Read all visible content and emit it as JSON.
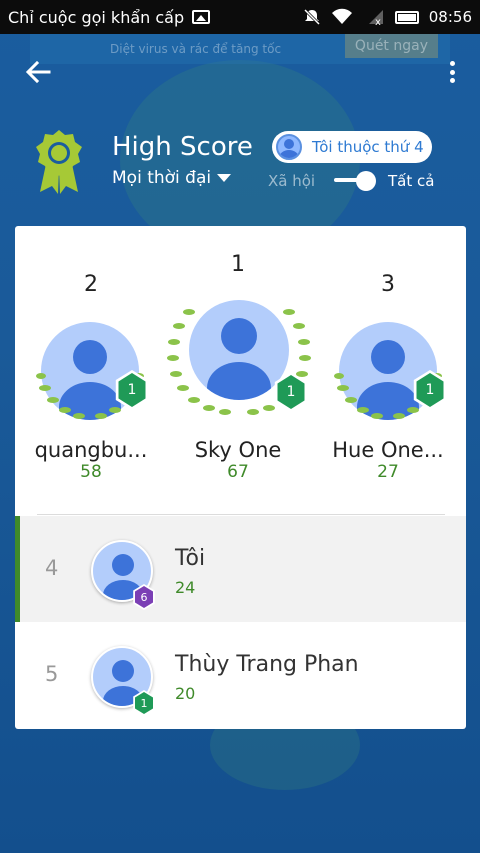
{
  "status_bar": {
    "carrier": "Chỉ cuộc gọi khẩn cấp",
    "time": "08:56",
    "icons": [
      "image-icon",
      "silent-icon",
      "wifi-icon",
      "signal-off-icon",
      "battery-icon"
    ]
  },
  "ad": {
    "text": "Diệt virus và rác để tăng tốc",
    "button": "Quét ngay"
  },
  "header": {
    "title": "High Score",
    "period": "Mọi thời đại",
    "my_rank_pill": "Tôi thuộc thứ 4",
    "social_label": "Xã hội",
    "all_label": "Tất cả",
    "toggle_on": true
  },
  "podium": [
    {
      "rank": "2",
      "name": "quangbu...",
      "score": "58",
      "level": "1"
    },
    {
      "rank": "1",
      "name": "Sky One",
      "score": "67",
      "level": "1"
    },
    {
      "rank": "3",
      "name": "Hue One...",
      "score": "27",
      "level": "1"
    }
  ],
  "list": [
    {
      "rank": "4",
      "name": "Tôi",
      "score": "24",
      "level": "6",
      "level_color": "#7b3fb5",
      "is_me": true
    },
    {
      "rank": "5",
      "name": "Thùy Trang Phan",
      "score": "20",
      "level": "1",
      "level_color": "#1f9a57",
      "is_me": false
    }
  ],
  "colors": {
    "accent_green": "#3f8a2a",
    "level_green": "#1f9a57",
    "avatar_blue": "#3d73d9",
    "background_blue": "#1a5d9f"
  }
}
